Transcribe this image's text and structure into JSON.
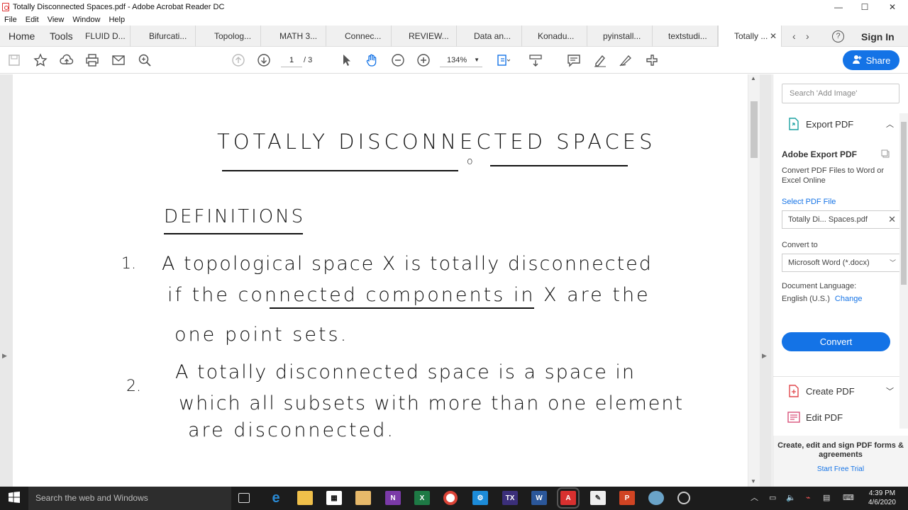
{
  "window": {
    "title": "Totally Disconnected Spaces.pdf - Adobe Acrobat Reader DC",
    "minimize": "—",
    "maximize": "☐",
    "close": "✕"
  },
  "menu": [
    "File",
    "Edit",
    "View",
    "Window",
    "Help"
  ],
  "tabbar": {
    "home": "Home",
    "tools": "Tools",
    "tabs": [
      "FLUID D...",
      "Bifurcati...",
      "Topolog...",
      "MATH 3...",
      "Connec...",
      "REVIEW...",
      "Data an...",
      "Konadu...",
      "pyinstall...",
      "textstudi...",
      "Totally ..."
    ],
    "prev_arrow": "‹",
    "next_arrow": "›",
    "help": "?",
    "signin": "Sign In"
  },
  "toolbar": {
    "page_current": "1",
    "page_total": "/ 3",
    "zoom": "134%",
    "share": "Share",
    "icons": [
      "save-icon",
      "star-icon",
      "upload-icon",
      "print-icon",
      "mail-icon",
      "search-icon",
      "page-up-icon",
      "page-down-icon",
      "select-cursor-icon",
      "hand-icon",
      "zoom-out-icon",
      "zoom-in-icon",
      "fit-page-icon",
      "scroll-mode-icon",
      "comment-icon",
      "highlight-icon",
      "sign-icon",
      "tools-icon"
    ]
  },
  "document": {
    "title": "TOTALLY DISCONNECTED SPACES",
    "section": "DEFINITIONS",
    "items": [
      {
        "num": "1.",
        "lines": [
          "A topological space X is totally disconnected",
          "if the connected components in X are the",
          "one point sets."
        ]
      },
      {
        "num": "2.",
        "lines": [
          "A totally disconnected space is a space in",
          "which all subsets with more than one element",
          "are disconnected."
        ]
      }
    ]
  },
  "right_panel": {
    "search_placeholder": "Search 'Add Image'",
    "export_pdf": "Export PDF",
    "adobe_export_title": "Adobe Export PDF",
    "adobe_export_desc": "Convert PDF Files to Word or Excel Online",
    "select_pdf_label": "Select PDF File",
    "selected_file": "Totally Di... Spaces.pdf",
    "convert_to_label": "Convert to",
    "convert_to_value": "Microsoft Word (*.docx)",
    "doc_language_label": "Document Language:",
    "doc_language_value": "English (U.S.)",
    "change_link": "Change",
    "convert_button": "Convert",
    "create_pdf": "Create PDF",
    "edit_pdf": "Edit PDF",
    "promo_text": "Create, edit and sign PDF forms & agreements",
    "promo_link": "Start Free Trial"
  },
  "taskbar": {
    "search_placeholder": "Search the web and Windows",
    "time": "4:39 PM",
    "date": "4/6/2020"
  },
  "colors": {
    "accent": "#1473e6",
    "taskbar": "#1c1c1c"
  }
}
